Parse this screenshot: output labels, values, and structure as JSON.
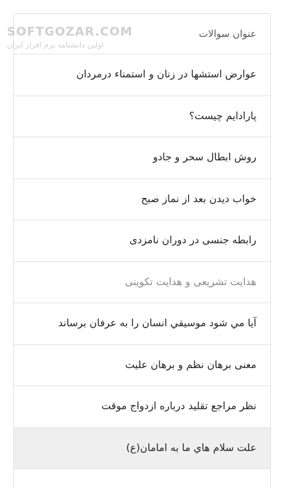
{
  "list": {
    "header_label": "عنوان سوالات",
    "items": [
      {
        "label": "عوارض استشها در زنان و استمناء درمردان",
        "state": "normal"
      },
      {
        "label": "پارادایم چیست؟",
        "state": "normal"
      },
      {
        "label": "روش ابطال سحر و جادو",
        "state": "normal"
      },
      {
        "label": "خواب دیدن بعد از نماز صبح",
        "state": "normal"
      },
      {
        "label": "رابطه جنسی در دوران نامزدی",
        "state": "normal"
      },
      {
        "label": "هدایت تشریعی و هدایت تکوینی",
        "state": "muted"
      },
      {
        "label": "آیا مي شود موسيقي انسان را به عرفان برساند",
        "state": "normal"
      },
      {
        "label": "معنی برهان نظم و برهان علیت",
        "state": "normal"
      },
      {
        "label": "نظر مراجع تقلید درباره ازدواج موقت",
        "state": "normal"
      },
      {
        "label": "علت سلام هاي ما به امامان(ع)",
        "state": "selected"
      }
    ]
  },
  "watermark": {
    "brand": "SOFTGOZAR.COM",
    "tagline": "اولین دانشنامه نرم افزار ایران"
  }
}
